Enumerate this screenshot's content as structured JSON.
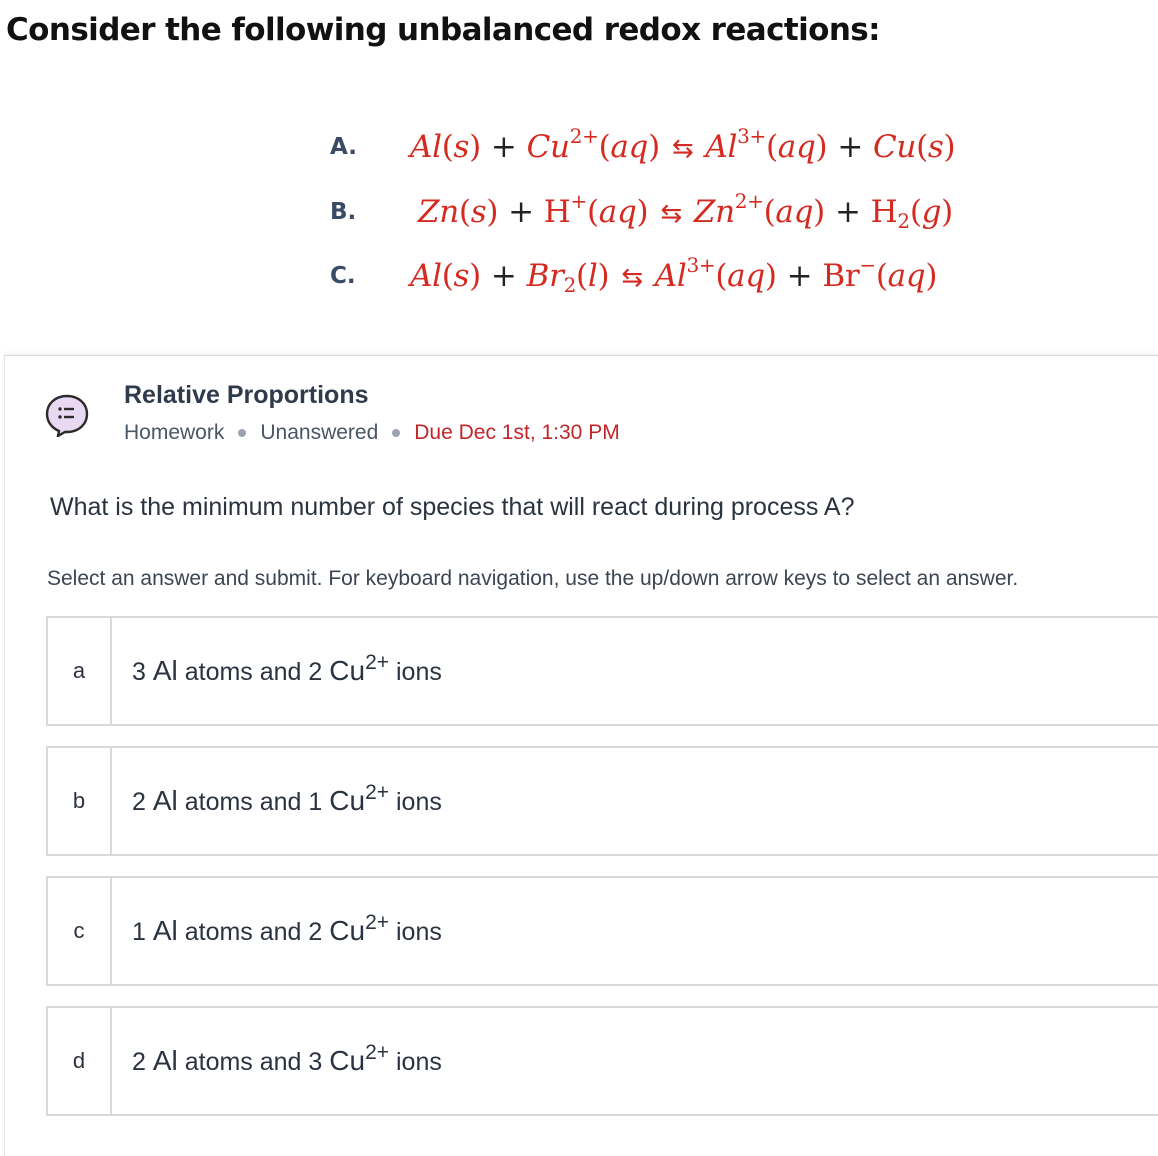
{
  "intro": "Consider the following unbalanced redox reactions:",
  "reactions": [
    {
      "label": "A.",
      "lhs1": "Al(s)",
      "lhs2_base": "Cu",
      "lhs2_charge": "2+",
      "lhs2_state": "(aq)",
      "rhs1_base": "Al",
      "rhs1_charge": "3+",
      "rhs1_state": "(aq)",
      "rhs2": "Cu(s)"
    },
    {
      "label": "B.",
      "lhs1": "Zn(s)",
      "lhs2_base": "H",
      "lhs2_charge": "+",
      "lhs2_state": "(aq)",
      "rhs1_base": "Zn",
      "rhs1_charge": "2+",
      "rhs1_state": "(aq)",
      "rhs2_base": "H",
      "rhs2_sub": "2",
      "rhs2_state": "(g)"
    },
    {
      "label": "C.",
      "lhs1": "Al(s)",
      "lhs2_base": "Br",
      "lhs2_sub": "2",
      "lhs2_state": "(l)",
      "rhs1_base": "Al",
      "rhs1_charge": "3+",
      "rhs1_state": "(aq)",
      "rhs2_base": "Br",
      "rhs2_charge": "−",
      "rhs2_state": "(aq)"
    }
  ],
  "symbols": {
    "plus": "+",
    "arrow": "⇆"
  },
  "question_card": {
    "icon": "question-bubble-icon",
    "title": "Relative Proportions",
    "type": "Homework",
    "status": "Unanswered",
    "due": "Due Dec 1st, 1:30 PM"
  },
  "question": "What is the minimum number of species that will react during process A?",
  "instructions": "Select an answer and submit. For keyboard navigation, use the up/down arrow keys to select an answer.",
  "options": [
    {
      "letter": "a",
      "al": "3",
      "cu": "2"
    },
    {
      "letter": "b",
      "al": "2",
      "cu": "1"
    },
    {
      "letter": "c",
      "al": "1",
      "cu": "2"
    },
    {
      "letter": "d",
      "al": "2",
      "cu": "3"
    }
  ],
  "option_text": {
    "al_symbol": "Al",
    "atoms_and": "atoms and",
    "cu_symbol": "Cu",
    "cu_charge": "2+",
    "ions": "ions"
  },
  "colors": {
    "reaction": "#d42a20",
    "label": "#3a4b66",
    "due": "#c0262a",
    "icon_fill": "#e9d8f2",
    "icon_stroke": "#2b2b2b"
  }
}
